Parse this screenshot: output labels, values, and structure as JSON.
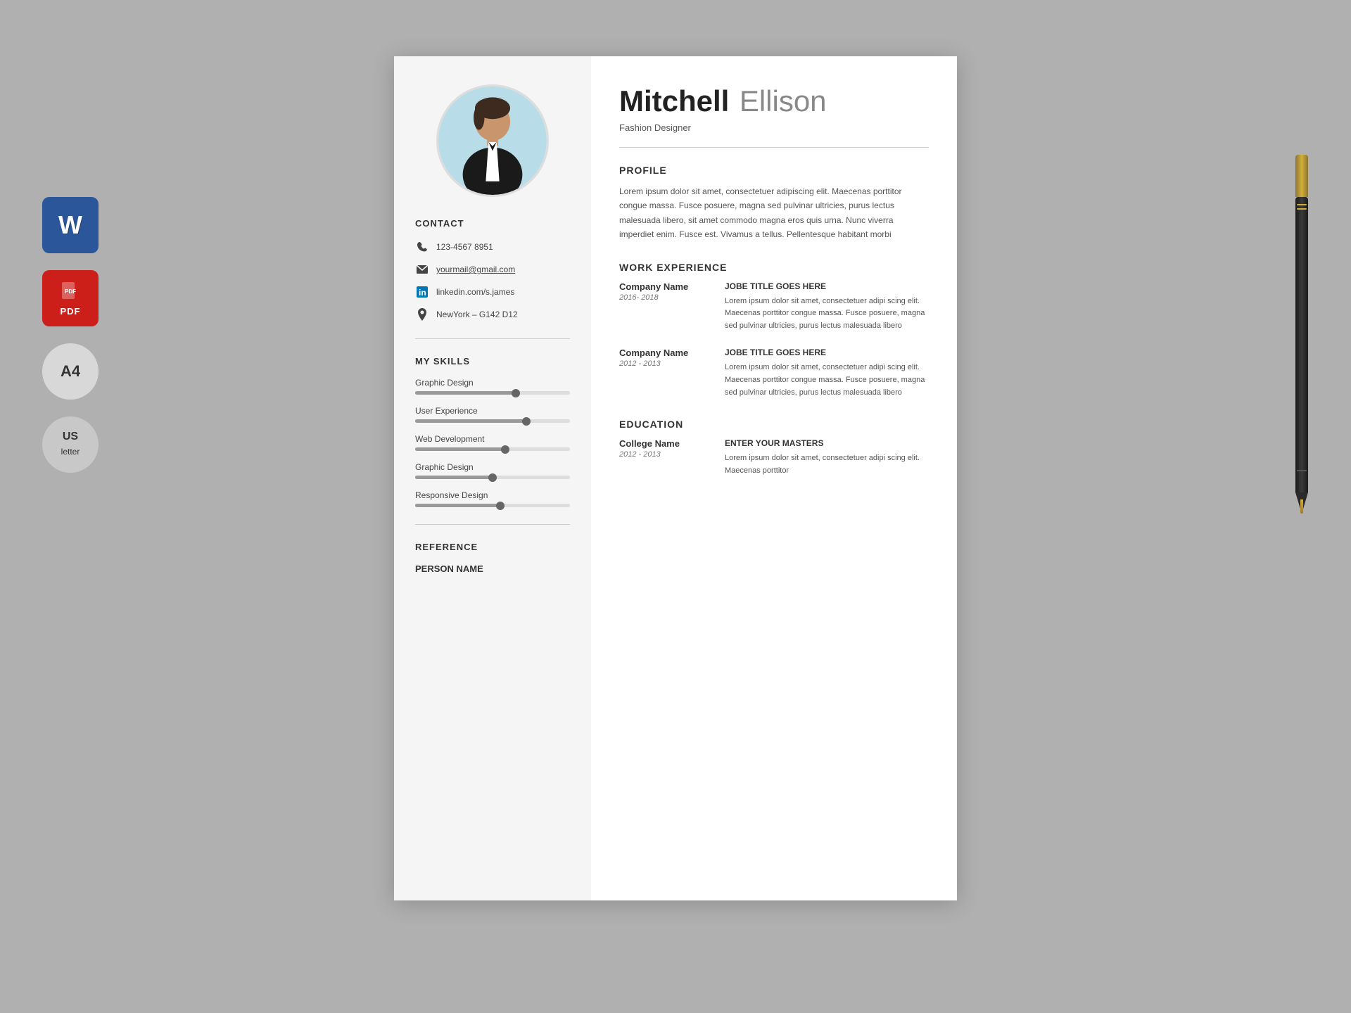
{
  "sidebar_icons": {
    "word_label": "W",
    "pdf_label": "PDF",
    "a4_label": "A4",
    "us_label": "US\nletter"
  },
  "left_panel": {
    "contact_section": "CONTACT",
    "phone": "123-4567 8951",
    "email": "yourmail@gmail.com",
    "linkedin": "linkedin.com/s.james",
    "location": "NewYork – G142 D12",
    "skills_section": "MY SKILLS",
    "skills": [
      {
        "name": "Graphic Design",
        "percent": 65
      },
      {
        "name": "User Experience",
        "percent": 72
      },
      {
        "name": "Web Development",
        "percent": 58
      },
      {
        "name": "Graphic Design",
        "percent": 50
      },
      {
        "name": "Responsive Design",
        "percent": 55
      }
    ],
    "reference_section": "REFERENCE",
    "person_name": "PERSON NAME"
  },
  "right_panel": {
    "name_first": "Mitchell",
    "name_last": "Ellison",
    "job_title": "Fashion Designer",
    "profile_heading": "PROFILE",
    "profile_text": "Lorem ipsum dolor sit amet, consectetuer adipiscing elit. Maecenas porttitor congue massa. Fusce posuere, magna sed pulvinar ultricies, purus lectus malesuada libero, sit amet commodo magna eros quis urna. Nunc viverra imperdiet enim. Fusce est. Vivamus a tellus. Pellentesque habitant morbi",
    "experience_heading": "WORK EXPERIENCE",
    "experiences": [
      {
        "company": "Company Name",
        "dates": "2016- 2018",
        "job_title": "JOBE TITLE GOES HERE",
        "description": "Lorem ipsum dolor sit amet, consectetuer adipi scing elit. Maecenas porttitor congue massa. Fusce posuere, magna sed pulvinar ultricies, purus lectus malesuada libero"
      },
      {
        "company": "Company Name",
        "dates": "2012 - 2013",
        "job_title": "JOBE TITLE GOES HERE",
        "description": "Lorem ipsum dolor sit amet, consectetuer adipi scing elit. Maecenas porttitor congue massa. Fusce posuere, magna sed pulvinar ultricies, purus lectus malesuada libero"
      }
    ],
    "education_heading": "EDUCATION",
    "education": [
      {
        "college": "College Name",
        "dates": "2012 - 2013",
        "degree": "ENTER YOUR MASTERS",
        "description": "Lorem ipsum dolor sit amet, consectetuer adipi scing elit. Maecenas porttitor"
      }
    ]
  }
}
